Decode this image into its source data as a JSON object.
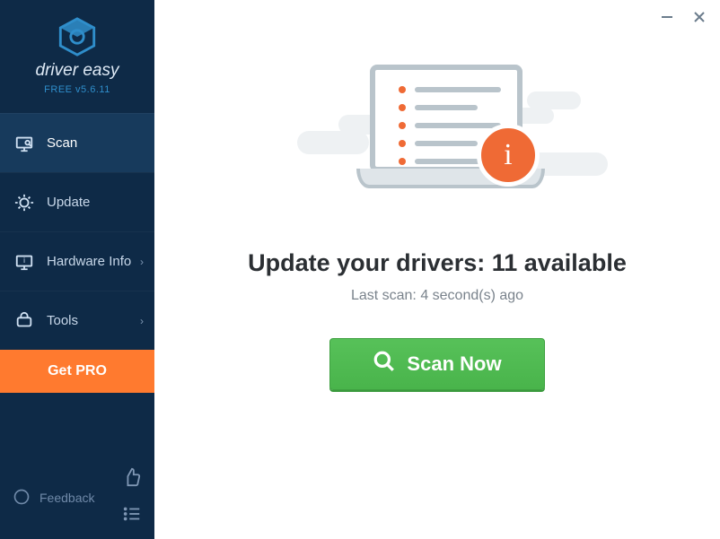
{
  "brand": {
    "name": "driver easy",
    "version_label": "FREE v5.6.11"
  },
  "sidebar": {
    "items": [
      {
        "label": "Scan"
      },
      {
        "label": "Update"
      },
      {
        "label": "Hardware Info"
      },
      {
        "label": "Tools"
      }
    ],
    "get_pro_label": "Get PRO",
    "feedback_label": "Feedback"
  },
  "main": {
    "headline": "Update your drivers: 11 available",
    "subline": "Last scan: 4 second(s) ago",
    "scan_button_label": "Scan Now"
  },
  "colors": {
    "sidebar_bg": "#0e2a47",
    "accent_orange": "#ff7a2f",
    "scan_green": "#4cb94e"
  }
}
